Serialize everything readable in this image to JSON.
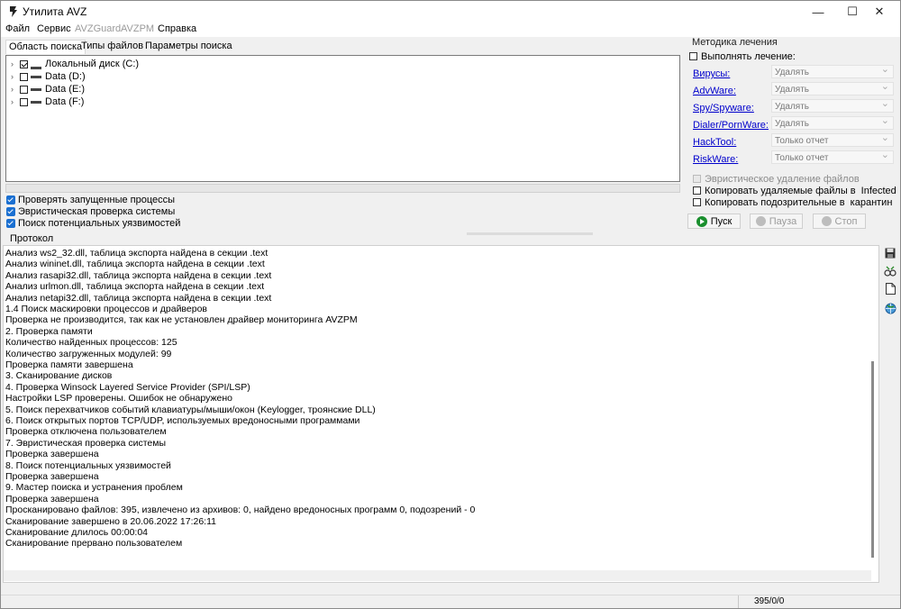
{
  "window": {
    "title": "Утилита AVZ"
  },
  "titlebar": {
    "minimize": "—",
    "maximize": "☐",
    "close": "✕"
  },
  "menu": [
    "Файл",
    "Сервис",
    "AVZGuard",
    "AVZPM",
    "Справка"
  ],
  "tabs": [
    "Область поиска",
    "Типы файлов",
    "Параметры поиска"
  ],
  "drives": [
    {
      "label": "Локальный диск (C:)",
      "checked": true
    },
    {
      "label": "Data (D:)",
      "checked": false
    },
    {
      "label": "Data (E:)",
      "checked": false
    },
    {
      "label": "Data (F:)",
      "checked": false
    }
  ],
  "scan_options": [
    "Проверять запущенные процессы",
    "Эвристическая проверка системы",
    "Поиск потенциальных уязвимостей"
  ],
  "treatment": {
    "group_title": "Методика лечения",
    "perform_label": "Выполнять лечение:",
    "threats": [
      {
        "label": "Вирусы:",
        "action": "Удалять"
      },
      {
        "label": "AdvWare:",
        "action": "Удалять"
      },
      {
        "label": "Spy/Spyware:",
        "action": "Удалять"
      },
      {
        "label": "Dialer/PornWare:",
        "action": "Удалять"
      },
      {
        "label": "HackTool:",
        "action": "Только отчет"
      },
      {
        "label": "RiskWare:",
        "action": "Только отчет"
      }
    ],
    "heuristic_delete": "Эвристическое удаление файлов",
    "copy_deleted": "Копировать удаляемые файлы в",
    "copy_deleted_dest": "Infected",
    "copy_suspicious": "Копировать подозрительные в",
    "copy_suspicious_dest": "карантин"
  },
  "actions": {
    "start": "Пуск",
    "pause": "Пауза",
    "stop": "Стоп"
  },
  "protocol": {
    "title": "Протокол",
    "lines": [
      " Анализ ws2_32.dll, таблица экспорта найдена в секции .text",
      " Анализ wininet.dll, таблица экспорта найдена в секции .text",
      " Анализ rasapi32.dll, таблица экспорта найдена в секции .text",
      " Анализ urlmon.dll, таблица экспорта найдена в секции .text",
      " Анализ netapi32.dll, таблица экспорта найдена в секции .text",
      "1.4 Поиск маскировки процессов и драйверов",
      " Проверка не производится, так как не установлен драйвер мониторинга AVZPM",
      "2. Проверка памяти",
      " Количество найденных процессов: 125",
      " Количество загруженных модулей: 99",
      "Проверка памяти завершена",
      "3. Сканирование дисков",
      "4. Проверка Winsock Layered Service Provider (SPI/LSP)",
      " Настройки LSP проверены. Ошибок не обнаружено",
      "5. Поиск перехватчиков событий клавиатуры/мыши/окон (Keylogger, троянские DLL)",
      "6. Поиск открытых портов TCP/UDP, используемых вредоносными программами",
      " Проверка отключена пользователем",
      "7. Эвристическая проверка системы",
      "Проверка завершена",
      "8. Поиск потенциальных уязвимостей",
      "Проверка завершена",
      "9. Мастер поиска и устранения проблем",
      "Проверка завершена",
      "Просканировано файлов: 395, извлечено из архивов: 0, найдено вредоносных программ 0, подозрений - 0",
      "Сканирование завершено в 20.06.2022 17:26:11",
      "Сканирование длилось 00:00:04",
      "Сканирование прервано пользователем"
    ]
  },
  "side_icons": [
    "save-icon",
    "glasses-icon",
    "document-icon",
    "globe-icon"
  ],
  "status": {
    "counts": "395/0/0"
  }
}
